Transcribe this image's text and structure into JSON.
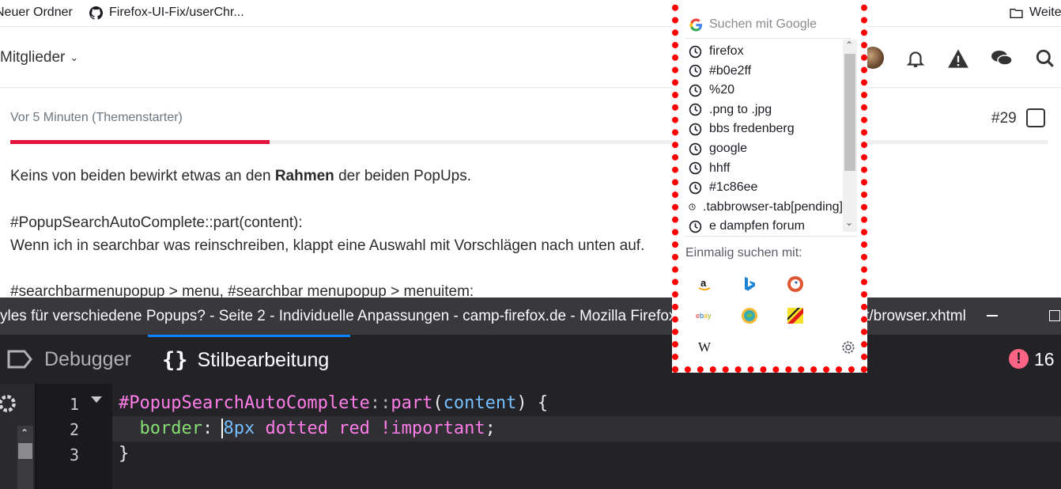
{
  "bookmarks": {
    "folder1": "Neuer Ordner",
    "github": "Firefox-UI-Fix/userChr...",
    "folder2": "Weitere"
  },
  "forum": {
    "members_label": "Mitglieder",
    "post_meta": "Vor 5 Minuten (Themenstarter)",
    "post_number": "#29",
    "read_progress": 0.25,
    "lines": {
      "l1_pre": "Keins von beiden bewirkt etwas an den ",
      "l1_bold": "Rahmen",
      "l1_post": " der beiden PopUps.",
      "l2": "#PopupSearchAutoComplete::part(content):",
      "l3": "Wenn ich in searchbar was reinschreiben, klappt eine Auswahl mit Vorschlägen nach unten auf.",
      "l4": "#searchbarmenupopup > menu, #searchbar menupopup > menuitem:"
    }
  },
  "devtools": {
    "window_title": "yles für verschiedene Popups? - Seite 2 - Individuelle Anpassungen - camp-firefox.de - Mozilla Firefox — chrome://browser/content/browser.xhtml",
    "tab_debugger": "Debugger",
    "tab_style": "Stilbearbeitung",
    "error_count": "16",
    "line_numbers": [
      "1",
      "2",
      "3"
    ],
    "code": {
      "selector": "#PopupSearchAutoComplete",
      "pseudo": "::",
      "fn": "part",
      "paren_open": "(",
      "arg": "content",
      "paren_close": ")",
      "brace_open": " {",
      "prop": "border",
      "colon": ": ",
      "val_num": "8px",
      "val_rest": " dotted red",
      "important": " !important",
      "semi": ";",
      "brace_close": "}"
    }
  },
  "popup": {
    "search_placeholder": "Suchen mit Google",
    "suggestions": [
      "firefox",
      "#b0e2ff",
      "%20",
      ".png to .jpg",
      "bbs fredenberg",
      "google",
      "hhff",
      "#1c86ee",
      ".tabbrowser-tab[pending]",
      "e dampfen forum"
    ],
    "oneoff_label": "Einmalig suchen mit:",
    "engines": [
      "amazon-icon",
      "bing-icon",
      "duckduckgo-icon",
      "ebay-icon",
      "ecosia-icon",
      "leo-icon",
      "wikipedia-icon"
    ]
  },
  "colors": {
    "accent_red": "#e2143d",
    "popup_border": "#ff0000",
    "devtools_bg": "#232327",
    "devtools_accent": "#0a84ff",
    "error_pink": "#ff6485"
  }
}
